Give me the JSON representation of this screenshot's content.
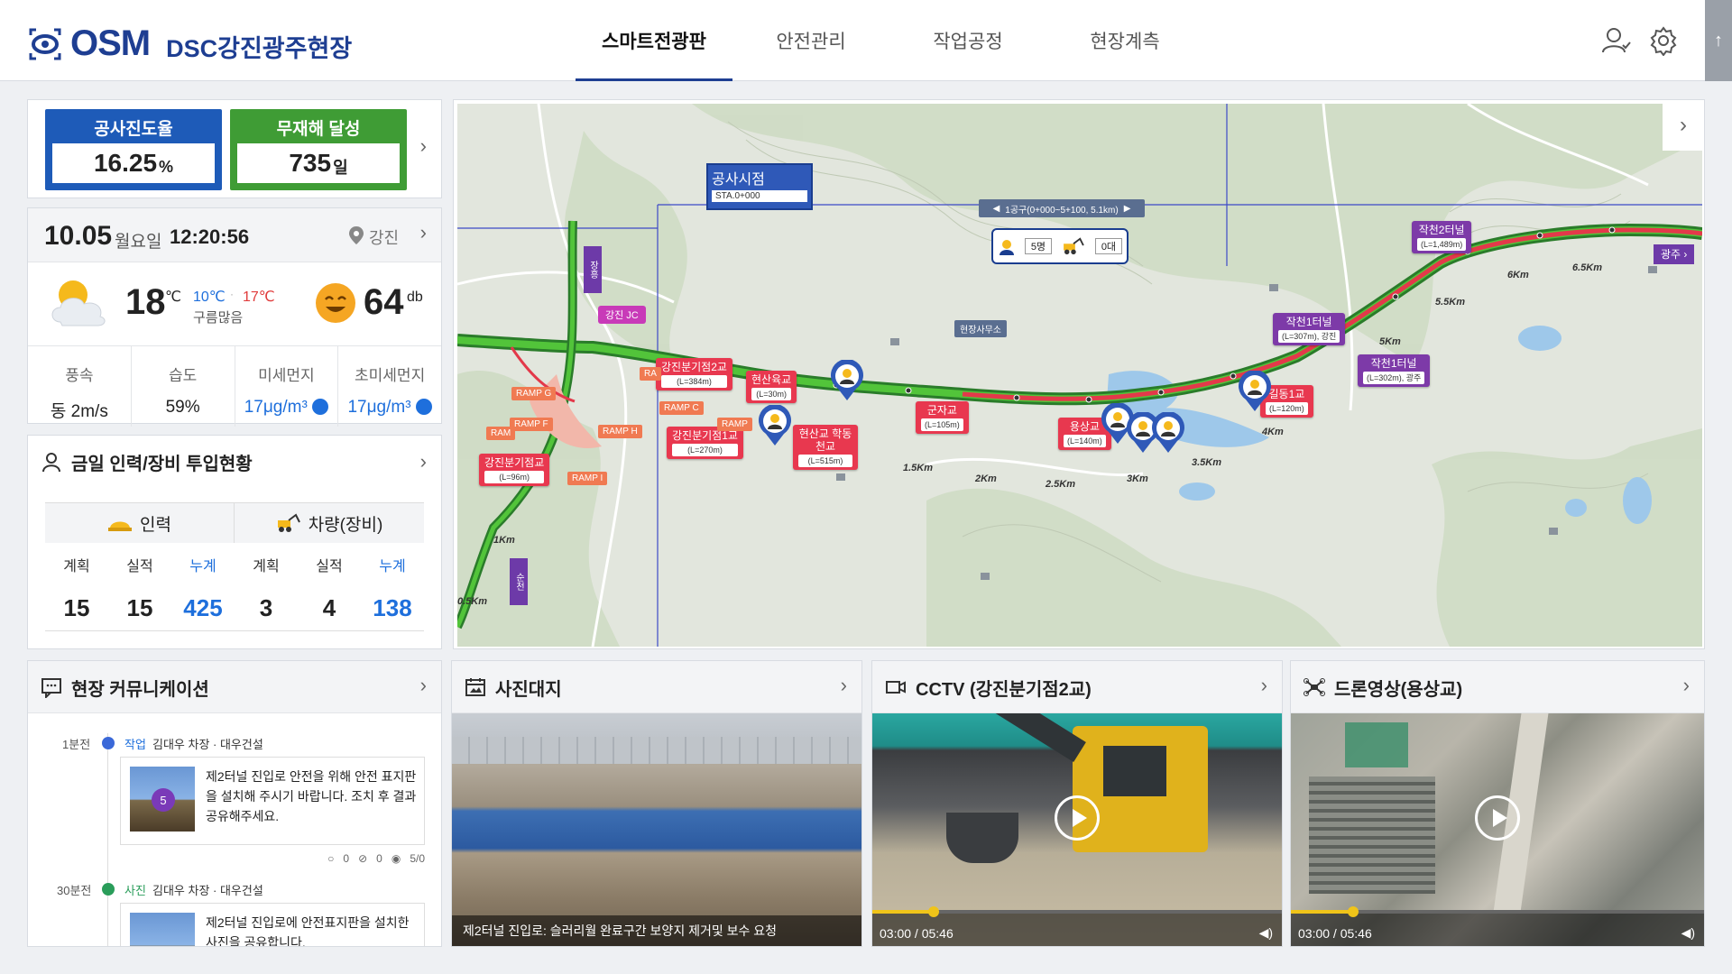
{
  "header": {
    "logo": "OSM",
    "site_name": "DSC강진광주현장",
    "nav": [
      "스마트전광판",
      "안전관리",
      "작업공정",
      "현장계측"
    ],
    "active_nav": 0
  },
  "kpis": {
    "progress": {
      "label": "공사진도율",
      "value": "16.25",
      "unit": "%",
      "color": "#1e5bb8"
    },
    "accident_free": {
      "label": "무재해 달성",
      "value": "735",
      "unit": "일",
      "color": "#3f9c35"
    }
  },
  "weather": {
    "date": "10.05",
    "weekday": "월요일",
    "time": "12:20:56",
    "location": "강진",
    "temp": "18",
    "temp_unit": "℃",
    "low": "10℃",
    "high": "17℃",
    "condition": "구름많음",
    "noise": "64",
    "noise_unit": "db",
    "metrics": [
      {
        "label": "풍속",
        "value": "동 2m/s"
      },
      {
        "label": "습도",
        "value": "59%"
      },
      {
        "label": "미세먼지",
        "value": "17μg/m³"
      },
      {
        "label": "초미세먼지",
        "value": "17μg/m³"
      }
    ]
  },
  "workforce": {
    "title": "금일 인력/장비 투입현황",
    "groups": [
      {
        "label": "인력",
        "icon": "hardhat-icon"
      },
      {
        "label": "차량(장비)",
        "icon": "excavator-icon"
      }
    ],
    "cols": [
      "계획",
      "실적",
      "누계",
      "계획",
      "실적",
      "누계"
    ],
    "values": [
      "15",
      "15",
      "425",
      "3",
      "4",
      "138"
    ]
  },
  "map": {
    "start": {
      "title": "공사시점",
      "sta": "STA.0+000"
    },
    "section": "1공구(0+000~5+100, 5.1km)",
    "counter": {
      "people": "5명",
      "vehicles": "0대"
    },
    "office": "현장사무소",
    "jc": "강진 JC",
    "dir_up": "장흥",
    "dir_down": "순천",
    "dir_right": "광주",
    "bridges": [
      {
        "name": "강진분기점2교",
        "len": "(L=384m)"
      },
      {
        "name": "현산육교",
        "len": "(L=30m)"
      },
      {
        "name": "강진분기점1교",
        "len": "(L=270m)"
      },
      {
        "name": "현산교 학동천교",
        "len": "(L=515m)"
      },
      {
        "name": "군자교",
        "len": "(L=105m)"
      },
      {
        "name": "용상교",
        "len": "(L=140m)"
      },
      {
        "name": "길동1교",
        "len": "(L=120m)"
      },
      {
        "name": "강진분기점교",
        "len": "(L=96m)"
      }
    ],
    "tunnels": [
      {
        "name": "작천2터널",
        "len": "(L=1,489m)"
      },
      {
        "name": "작천1터널",
        "len": "(L=307m), 강진"
      },
      {
        "name": "작천1터널",
        "len": "(L=302m), 광주"
      }
    ],
    "ramps": [
      "RAMP G",
      "RAMP C",
      "RAMP F",
      "RAMP H",
      "RAMP I",
      "RAMP",
      "RAM",
      "RA"
    ],
    "km": [
      "1.5Km",
      "2Km",
      "2.5Km",
      "3Km",
      "3.5Km",
      "4Km",
      "5Km",
      "5.5Km",
      "6Km",
      "6.5Km",
      "1Km",
      "0.5Km"
    ]
  },
  "community": {
    "title": "현장 커뮤니케이션",
    "items": [
      {
        "ago": "1분전",
        "tag": "작업",
        "author": "김대우 차장 · 대우건설",
        "text": "제2터널 진입로 안전을 위해 안전 표지판을 설치해 주시기 바랍니다. 조치 후 결과 공유해주세요.",
        "thumb_count": "5",
        "comments": "0",
        "attachments": "0",
        "views": "5/0",
        "dot": "#3a68d8"
      },
      {
        "ago": "30분전",
        "tag": "사진",
        "author": "김대우 차장 · 대우건설",
        "text": "제2터널 진입로에 안전표지판을 설치한 사진을 공유합니다.",
        "dot": "#2a9d5a"
      }
    ]
  },
  "photos": {
    "title": "사진대지",
    "caption": "제2터널 진입로: 슬러리월 완료구간 보양지 제거및 보수 요청"
  },
  "cctv": {
    "title": "CCTV (강진분기점2교)",
    "time": "03:00 / 05:46",
    "progress": 0.15
  },
  "drone": {
    "title": "드론영상(용상교)",
    "time": "03:00 / 05:46",
    "progress": 0.15
  }
}
